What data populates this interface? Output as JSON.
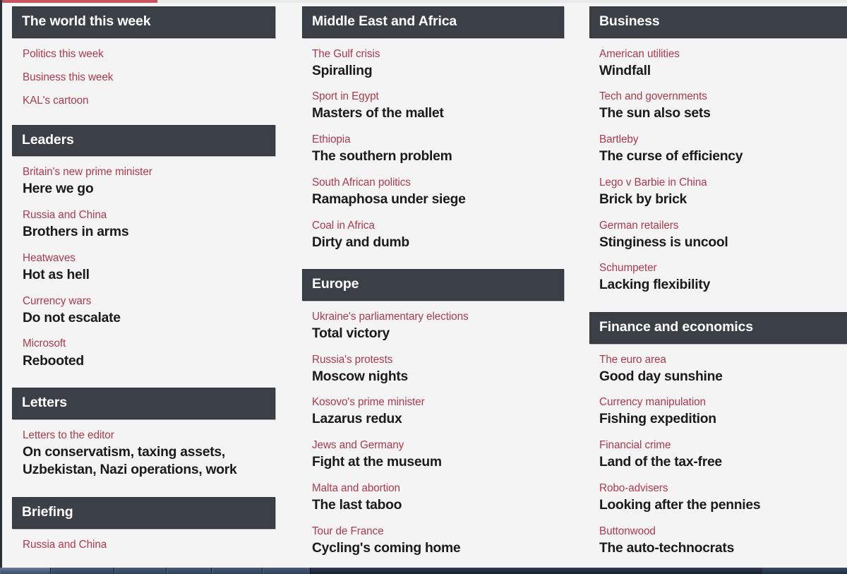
{
  "colors": {
    "header_bar": "#3b4047",
    "flytitle_red": "#ab3b4c",
    "headline_black": "#1a1a1a",
    "page_background": "#f4f4f4",
    "top_rule_red": "#c8535f"
  },
  "columns": [
    {
      "name": "column-1",
      "sections": [
        {
          "title": "The world this week",
          "articles": [
            {
              "flytitle": "Politics this week",
              "headline": ""
            },
            {
              "flytitle": "Business this week",
              "headline": ""
            },
            {
              "flytitle": "KAL's cartoon",
              "headline": ""
            }
          ]
        },
        {
          "title": "Leaders",
          "articles": [
            {
              "flytitle": "Britain's new prime minister",
              "headline": "Here we go"
            },
            {
              "flytitle": "Russia and China",
              "headline": "Brothers in arms"
            },
            {
              "flytitle": "Heatwaves",
              "headline": "Hot as hell"
            },
            {
              "flytitle": "Currency wars",
              "headline": "Do not escalate"
            },
            {
              "flytitle": "Microsoft",
              "headline": "Rebooted"
            }
          ]
        },
        {
          "title": "Letters",
          "articles": [
            {
              "flytitle": "Letters to the editor",
              "headline": "On conservatism, taxing assets, Uzbekistan, Nazi operations, work"
            }
          ]
        },
        {
          "title": "Briefing",
          "articles": [
            {
              "flytitle": "Russia and China",
              "headline": ""
            }
          ]
        }
      ]
    },
    {
      "name": "column-2",
      "sections": [
        {
          "title": "Middle East and Africa",
          "articles": [
            {
              "flytitle": "The Gulf crisis",
              "headline": "Spiralling"
            },
            {
              "flytitle": "Sport in Egypt",
              "headline": "Masters of the mallet"
            },
            {
              "flytitle": "Ethiopia",
              "headline": "The southern problem"
            },
            {
              "flytitle": "South African politics",
              "headline": "Ramaphosa under siege"
            },
            {
              "flytitle": "Coal in Africa",
              "headline": "Dirty and dumb"
            }
          ]
        },
        {
          "title": "Europe",
          "articles": [
            {
              "flytitle": "Ukraine's parliamentary elections",
              "headline": "Total victory"
            },
            {
              "flytitle": "Russia's protests",
              "headline": "Moscow nights"
            },
            {
              "flytitle": "Kosovo's prime minister",
              "headline": "Lazarus redux"
            },
            {
              "flytitle": "Jews and Germany",
              "headline": "Fight at the museum"
            },
            {
              "flytitle": "Malta and abortion",
              "headline": "The last taboo"
            },
            {
              "flytitle": "Tour de France",
              "headline": "Cycling's coming home"
            }
          ]
        }
      ]
    },
    {
      "name": "column-3",
      "sections": [
        {
          "title": "Business",
          "articles": [
            {
              "flytitle": "American utilities",
              "headline": "Windfall"
            },
            {
              "flytitle": "Tech and governments",
              "headline": "The sun also sets"
            },
            {
              "flytitle": "Bartleby",
              "headline": "The curse of efficiency"
            },
            {
              "flytitle": "Lego v Barbie in China",
              "headline": "Brick by brick"
            },
            {
              "flytitle": "German retailers",
              "headline": "Stinginess is uncool"
            },
            {
              "flytitle": "Schumpeter",
              "headline": "Lacking flexibility"
            }
          ]
        },
        {
          "title": "Finance and economics",
          "articles": [
            {
              "flytitle": "The euro area",
              "headline": "Good day sunshine"
            },
            {
              "flytitle": "Currency manipulation",
              "headline": "Fishing expedition"
            },
            {
              "flytitle": "Financial crime",
              "headline": "Land of the tax-free"
            },
            {
              "flytitle": "Robo-advisers",
              "headline": "Looking after the pennies"
            },
            {
              "flytitle": "Buttonwood",
              "headline": "The auto-technocrats"
            }
          ]
        }
      ]
    }
  ]
}
